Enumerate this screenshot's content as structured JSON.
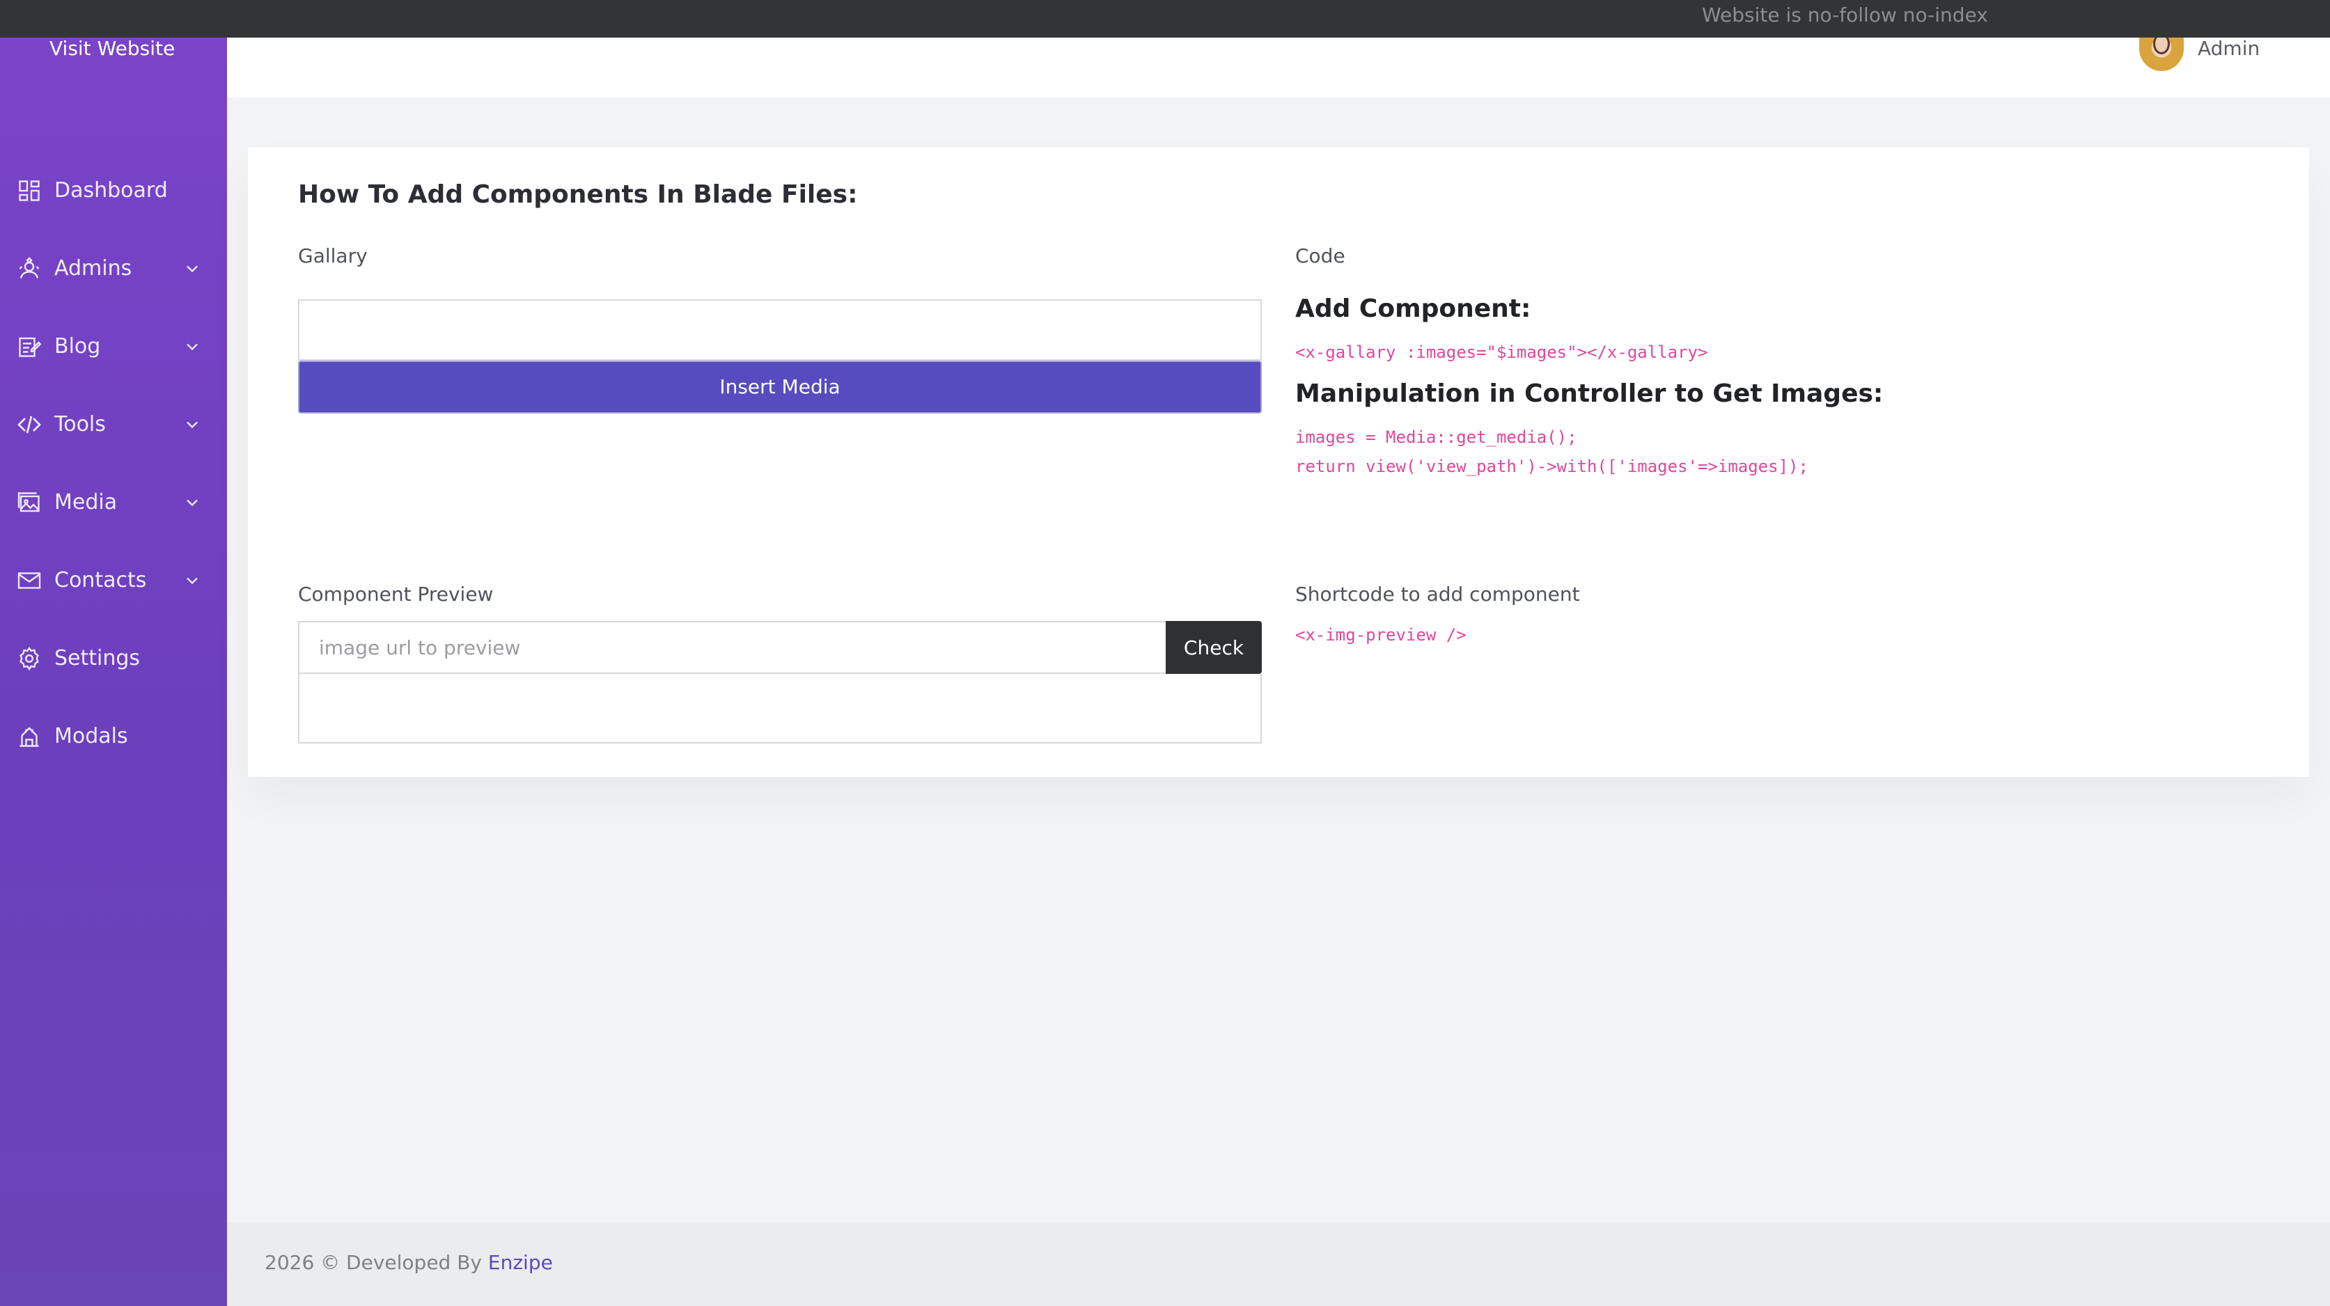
{
  "topbar": {
    "notice": "Website is no-follow no-index"
  },
  "sidebar": {
    "visit_label": "Visit Website",
    "items": [
      {
        "label": "Dashboard",
        "icon": "dashboard-icon",
        "expandable": false
      },
      {
        "label": "Admins",
        "icon": "admins-icon",
        "expandable": true
      },
      {
        "label": "Blog",
        "icon": "blog-icon",
        "expandable": true
      },
      {
        "label": "Tools",
        "icon": "code-icon",
        "expandable": true
      },
      {
        "label": "Media",
        "icon": "image-icon",
        "expandable": true
      },
      {
        "label": "Contacts",
        "icon": "mail-icon",
        "expandable": true
      },
      {
        "label": "Settings",
        "icon": "gear-icon",
        "expandable": false
      },
      {
        "label": "Modals",
        "icon": "modals-icon",
        "expandable": false
      }
    ]
  },
  "header": {
    "user_name": "Admin"
  },
  "main": {
    "title": "How To Add Components In Blade Files:",
    "gallery": {
      "label": "Gallary",
      "insert_button": "Insert Media"
    },
    "code": {
      "label": "Code",
      "add_heading": "Add Component:",
      "add_code": "<x-gallary :images=\"$images\"></x-gallary>",
      "manip_heading": "Manipulation in Controller to Get Images:",
      "manip_line1": "images = Media::get_media();",
      "manip_line2": "return view('view_path')->with(['images'=>images]);"
    },
    "preview": {
      "label": "Component Preview",
      "placeholder": "image url to preview",
      "value": "",
      "check_button": "Check"
    },
    "shortcode": {
      "label": "Shortcode to add component",
      "code": "<x-img-preview />"
    }
  },
  "footer": {
    "text": "2026 © Developed By",
    "brand": "Enzipe"
  },
  "colors": {
    "sidebar_top": "#7a44c9",
    "sidebar_bottom": "#6a45b6",
    "primary_button": "#564cbf",
    "dark_button": "#2f3032",
    "code_pink": "#e0479a",
    "topbar": "#333436"
  }
}
